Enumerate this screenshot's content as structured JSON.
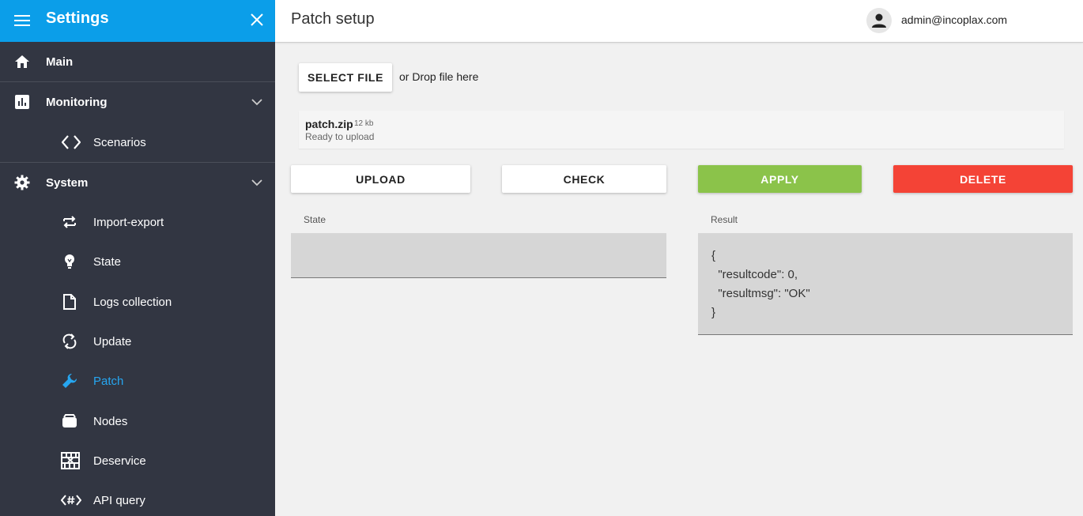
{
  "sidebar": {
    "title": "Settings",
    "items": [
      {
        "label": "Main",
        "icon": "home-icon"
      },
      {
        "label": "Monitoring",
        "icon": "bar-chart-icon"
      },
      {
        "label": "Scenarios",
        "icon": "code-brackets-icon"
      },
      {
        "label": "System",
        "icon": "gear-icon"
      },
      {
        "label": "Import-export",
        "icon": "swap-icon"
      },
      {
        "label": "State",
        "icon": "lightbulb-icon"
      },
      {
        "label": "Logs collection",
        "icon": "file-icon"
      },
      {
        "label": "Update",
        "icon": "sync-icon"
      },
      {
        "label": "Patch",
        "icon": "wrench-icon"
      },
      {
        "label": "Nodes",
        "icon": "box-icon"
      },
      {
        "label": "Deservice",
        "icon": "server-rack-icon"
      },
      {
        "label": "API query",
        "icon": "code-hash-icon"
      }
    ],
    "active_color": "#26a6f0",
    "header_color": "#0b9ee9"
  },
  "header": {
    "title": "Patch setup",
    "user_email": "admin@incoplax.com"
  },
  "upload": {
    "select_label": "SELECT FILE",
    "drop_hint": "or Drop file here",
    "file_name": "patch.zip",
    "file_size": "12 kb",
    "file_status": "Ready to upload"
  },
  "actions": {
    "upload": "UPLOAD",
    "check": "CHECK",
    "apply": "APPLY",
    "delete": "DELETE"
  },
  "state": {
    "label": "State",
    "value": ""
  },
  "result": {
    "label": "Result",
    "lines": [
      "{",
      "  \"resultcode\": 0,",
      "  \"resultmsg\": \"OK\"",
      "}"
    ]
  }
}
